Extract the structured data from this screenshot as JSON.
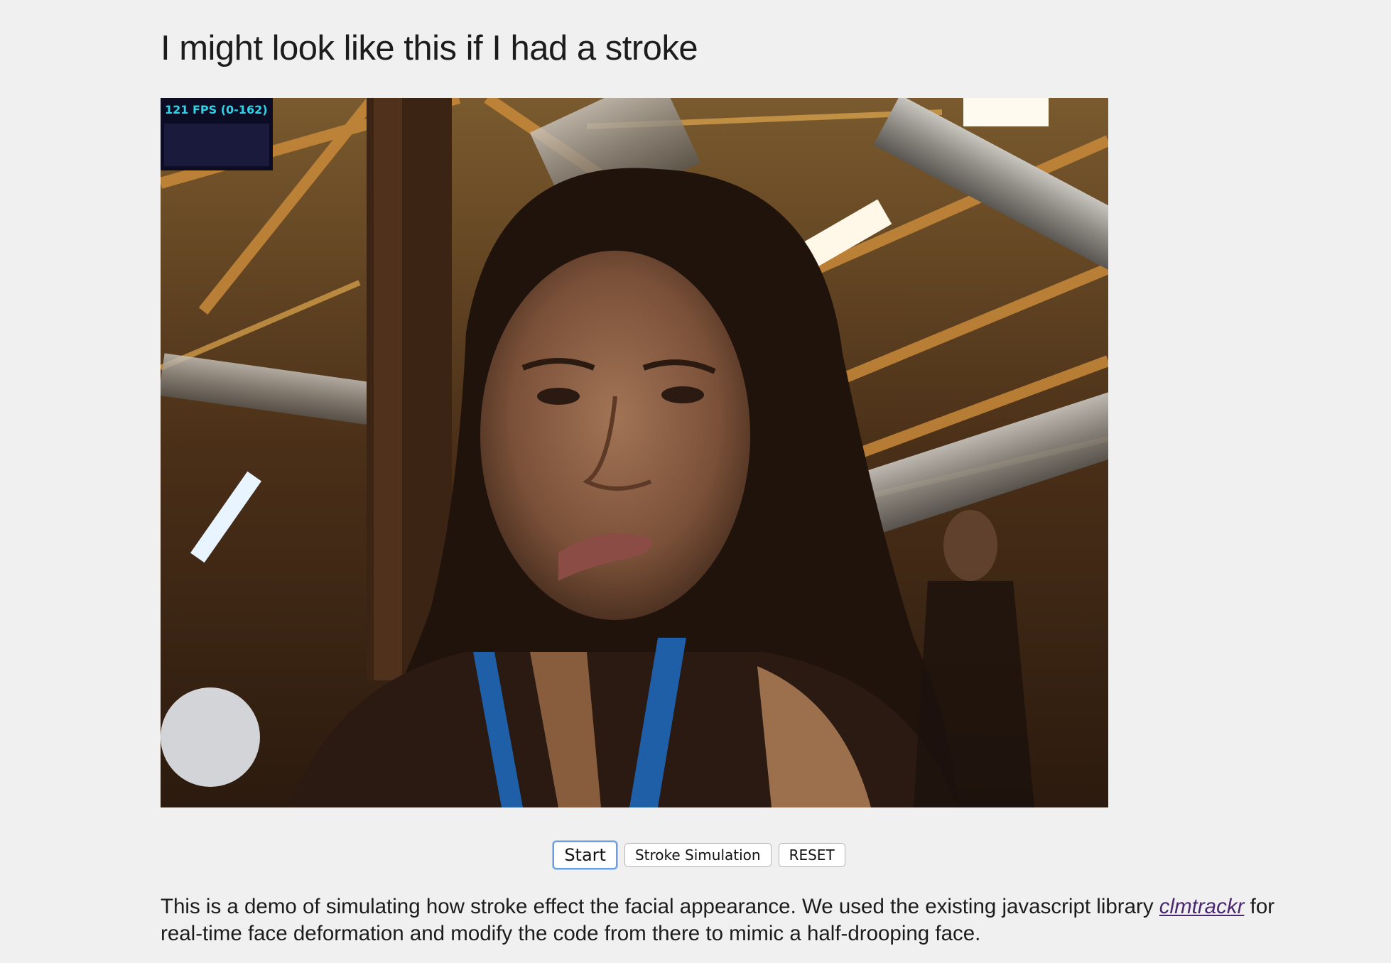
{
  "page": {
    "title": "I might look like this if I had a stroke"
  },
  "video": {
    "fps_label": "121 FPS (0-162)"
  },
  "controls": {
    "start_label": "Start",
    "stroke_label": "Stroke Simulation",
    "reset_label": "RESET"
  },
  "description": {
    "text_before": "This is a demo of simulating how stroke effect the facial appearance. We used the existing javascript library ",
    "link_text": "clmtrackr",
    "text_after": " for real-time face deformation and modify the code from there to mimic a half-drooping face."
  },
  "colors": {
    "background": "#f0f0f0",
    "fps_text": "#2fd2e6",
    "link": "#4a2770",
    "button_focus": "#6a9de3"
  }
}
